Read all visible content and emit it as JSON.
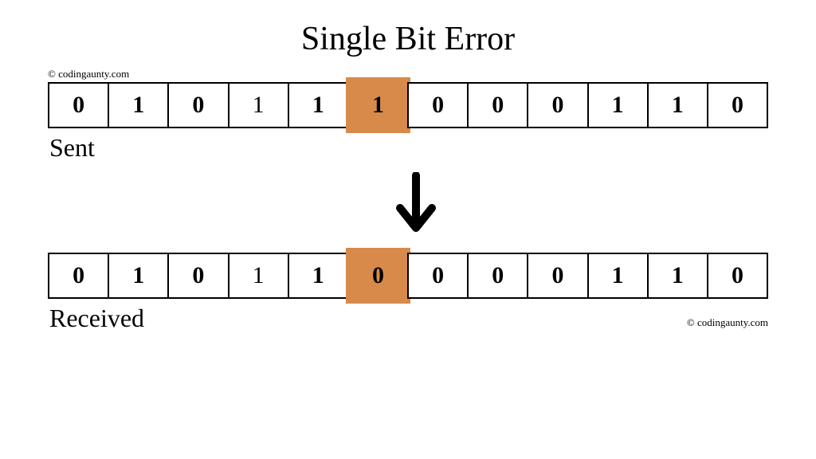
{
  "title": "Single Bit Error",
  "credit_text": "© codingaunty.com",
  "sent_label": "Sent",
  "received_label": "Received",
  "sent_bits": [
    "0",
    "1",
    "0",
    "1",
    "1",
    "1",
    "0",
    "0",
    "0",
    "1",
    "1",
    "0"
  ],
  "received_bits": [
    "0",
    "1",
    "0",
    "1",
    "1",
    "0",
    "0",
    "0",
    "0",
    "1",
    "1",
    "0"
  ],
  "highlight_index": 5,
  "thin_indices": [
    3
  ],
  "colors": {
    "highlight": "#d88a4a",
    "border": "#000000",
    "text": "#000000",
    "bg": "#ffffff"
  }
}
